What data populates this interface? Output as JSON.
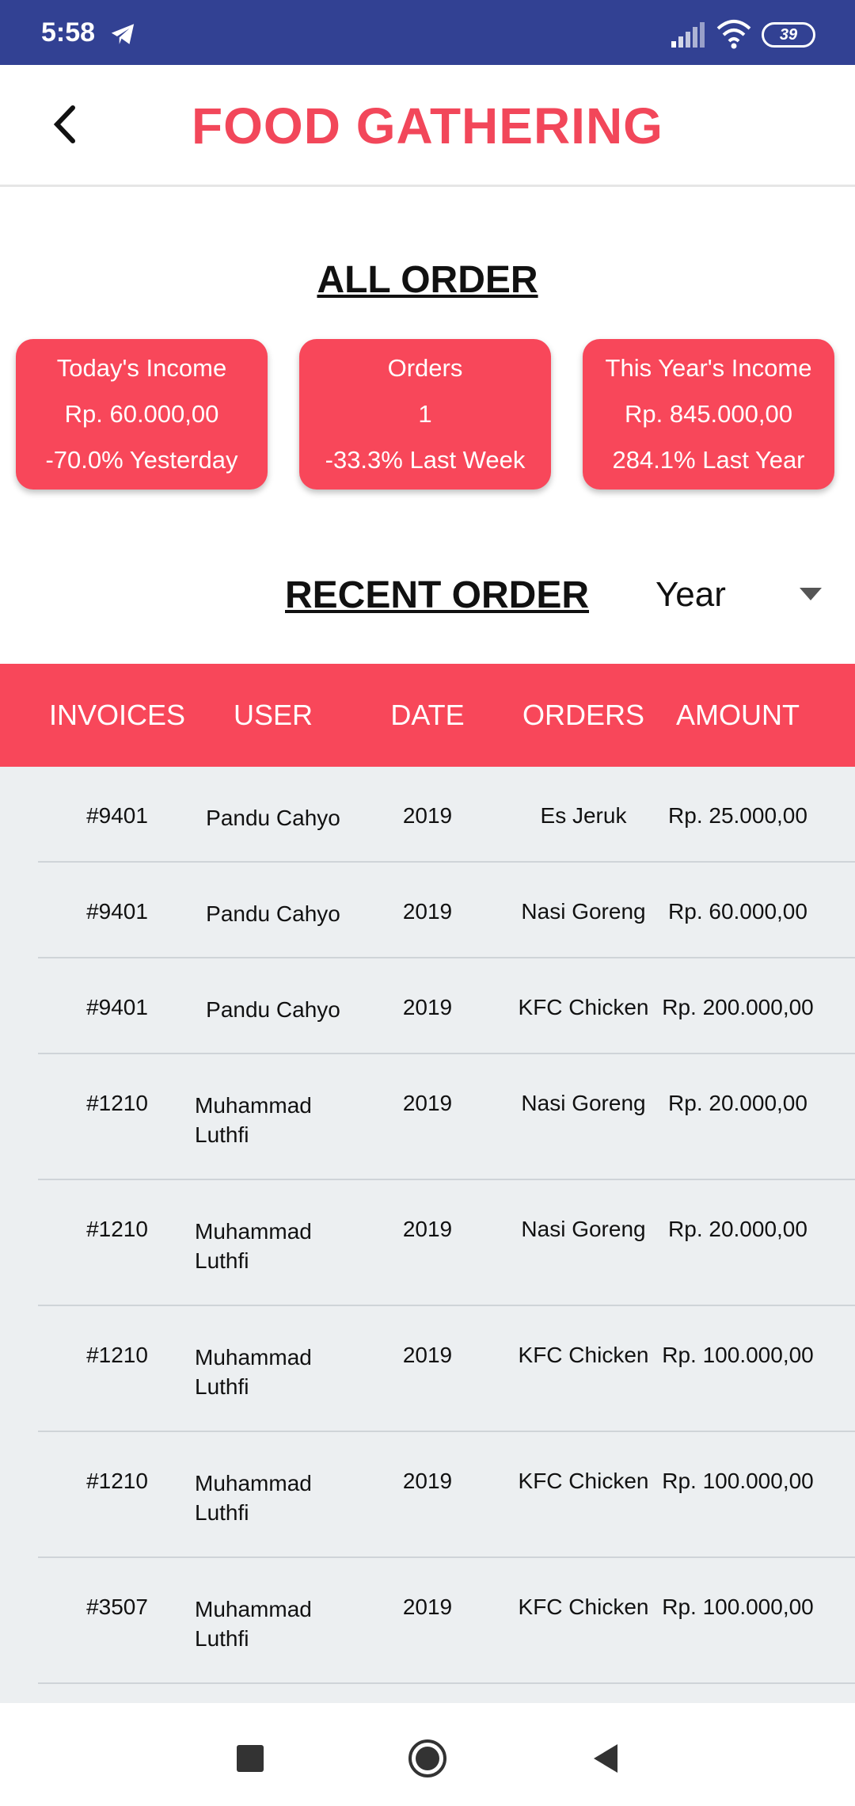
{
  "status_bar": {
    "time": "5:58",
    "battery": "39",
    "icons": [
      "telegram-icon",
      "signal-icon",
      "wifi-icon",
      "battery-icon"
    ]
  },
  "app_bar": {
    "title": "FOOD GATHERING",
    "back_icon": "chevron-left-icon"
  },
  "all_order": {
    "title": "ALL ORDER",
    "cards": [
      {
        "title": "Today's Income",
        "value": "Rp. 60.000,00",
        "change": "-70.0% Yesterday"
      },
      {
        "title": "Orders",
        "value": "1",
        "change": "-33.3% Last Week"
      },
      {
        "title": "This Year's Income",
        "value": "Rp. 845.000,00",
        "change": "284.1% Last Year"
      }
    ]
  },
  "recent_order": {
    "title": "RECENT ORDER",
    "filter": {
      "selected": "Year"
    },
    "columns": [
      "INVOICES",
      "USER",
      "DATE",
      "ORDERS",
      "AMOUNT"
    ],
    "rows": [
      {
        "invoice": "#9401",
        "user": "Pandu Cahyo",
        "date": "2019",
        "order": "Es Jeruk",
        "amount": "Rp. 25.000,00"
      },
      {
        "invoice": "#9401",
        "user": "Pandu Cahyo",
        "date": "2019",
        "order": "Nasi Goreng",
        "amount": "Rp. 60.000,00"
      },
      {
        "invoice": "#9401",
        "user": "Pandu Cahyo",
        "date": "2019",
        "order": "KFC Chicken",
        "amount": "Rp. 200.000,00"
      },
      {
        "invoice": "#1210",
        "user": "Muhammad Luthfi",
        "date": "2019",
        "order": "Nasi Goreng",
        "amount": "Rp. 20.000,00"
      },
      {
        "invoice": "#1210",
        "user": "Muhammad Luthfi",
        "date": "2019",
        "order": "Nasi Goreng",
        "amount": "Rp. 20.000,00"
      },
      {
        "invoice": "#1210",
        "user": "Muhammad Luthfi",
        "date": "2019",
        "order": "KFC Chicken",
        "amount": "Rp. 100.000,00"
      },
      {
        "invoice": "#1210",
        "user": "Muhammad Luthfi",
        "date": "2019",
        "order": "KFC Chicken",
        "amount": "Rp. 100.000,00"
      },
      {
        "invoice": "#3507",
        "user": "Muhammad Luthfi",
        "date": "2019",
        "order": "KFC Chicken",
        "amount": "Rp. 100.000,00"
      }
    ]
  },
  "colors": {
    "status_bar": "#324193",
    "accent": "#f8475a",
    "title": "#f2475a",
    "table_body": "#eceff1"
  }
}
